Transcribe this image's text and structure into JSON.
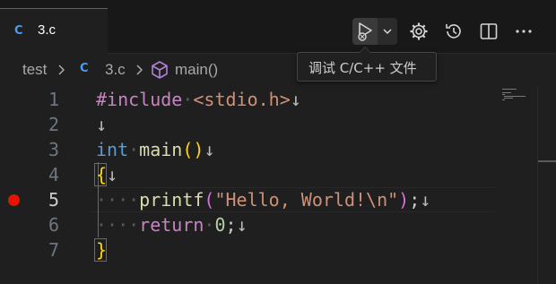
{
  "tab": {
    "label": "3.c",
    "file_icon": "C"
  },
  "toolbar": {
    "run_debug_icon": "run-debug-icon",
    "dropdown_icon": "chevron-down-icon",
    "settings_icon": "gear-icon",
    "history_icon": "history-icon",
    "split_icon": "split-editor-icon",
    "more_icon": "more-icon"
  },
  "tooltip": {
    "text": "调试 C/C++ 文件"
  },
  "breadcrumb": {
    "folder": "test",
    "file_icon": "C",
    "file": "3.c",
    "symbol_icon": "cube-icon",
    "symbol": "main()"
  },
  "editor": {
    "line_numbers": [
      "1",
      "2",
      "3",
      "4",
      "5",
      "6",
      "7"
    ],
    "active_line": "5",
    "breakpoint_line": "5",
    "lines": [
      {
        "tokens": [
          "#include",
          "·",
          "<stdio.h>",
          "↓"
        ]
      },
      {
        "tokens": [
          "↓"
        ]
      },
      {
        "tokens": [
          "int",
          "·",
          "main",
          "()",
          "↓"
        ]
      },
      {
        "tokens": [
          "{",
          "↓"
        ]
      },
      {
        "tokens": [
          "····",
          "printf",
          "(",
          "\"Hello, World!\\n\"",
          ")",
          ";",
          "↓"
        ]
      },
      {
        "tokens": [
          "····",
          "return",
          "·",
          "0",
          ";",
          "↓"
        ]
      },
      {
        "tokens": [
          "}"
        ]
      }
    ]
  },
  "colors": {
    "breakpoint": "#e51400",
    "keyword": "#569cd6",
    "preprocessor": "#c586c0",
    "string": "#ce9178",
    "function": "#dcdcaa",
    "number": "#b5cea8",
    "brace": "#ffd700",
    "accent": "#0078d4"
  }
}
